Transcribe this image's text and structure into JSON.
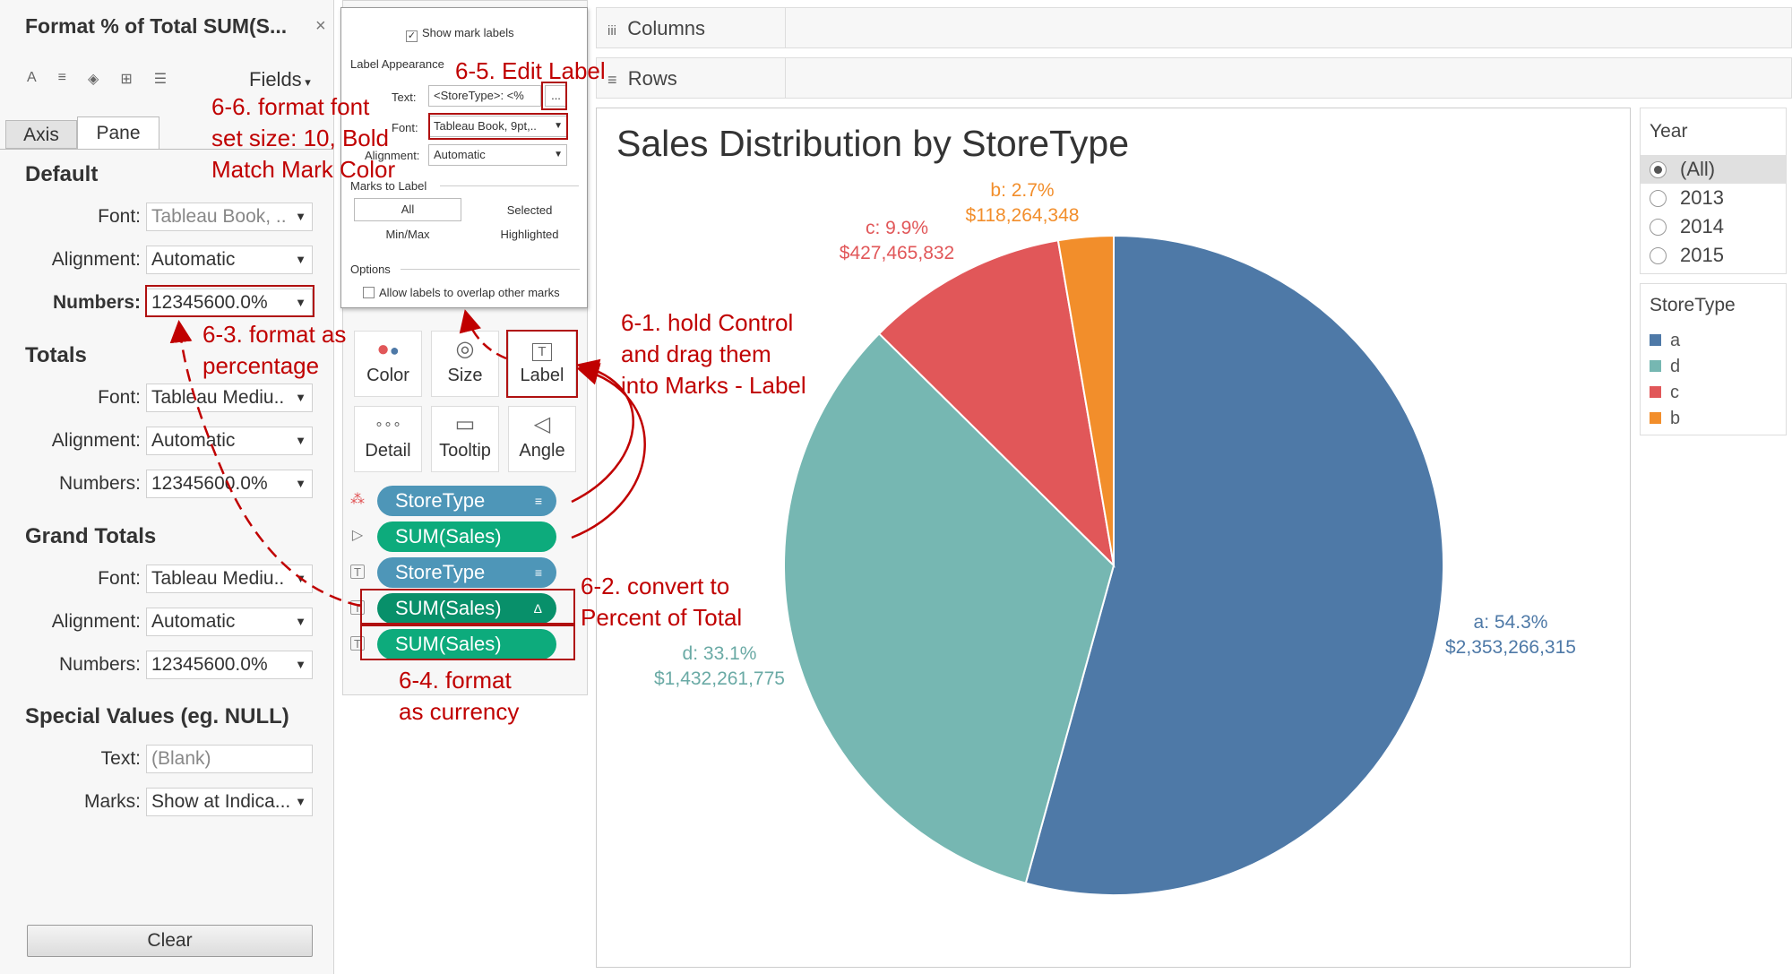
{
  "format_pane": {
    "title": "Format % of Total SUM(S...",
    "close": "×",
    "fields_label": "Fields",
    "tabs": {
      "axis": "Axis",
      "pane": "Pane"
    },
    "default": {
      "heading": "Default",
      "font_label": "Font:",
      "font_value": "Tableau Book, ..",
      "alignment_label": "Alignment:",
      "alignment_value": "Automatic",
      "numbers_label": "Numbers:",
      "numbers_value": "12345600.0%"
    },
    "totals": {
      "heading": "Totals",
      "font_label": "Font:",
      "font_value": "Tableau Mediu..",
      "alignment_label": "Alignment:",
      "alignment_value": "Automatic",
      "numbers_label": "Numbers:",
      "numbers_value": "12345600.0%"
    },
    "grand_totals": {
      "heading": "Grand Totals",
      "font_label": "Font:",
      "font_value": "Tableau Mediu..",
      "alignment_label": "Alignment:",
      "alignment_value": "Automatic",
      "numbers_label": "Numbers:",
      "numbers_value": "12345600.0%"
    },
    "special_values": {
      "heading": "Special Values (eg. NULL)",
      "text_label": "Text:",
      "text_placeholder": "(Blank)",
      "marks_label": "Marks:",
      "marks_value": "Show at Indica..."
    },
    "clear_label": "Clear"
  },
  "label_dialog": {
    "show_mark_labels": "Show mark labels",
    "label_appearance": "Label Appearance",
    "text_label": "Text:",
    "text_value": "<StoreType>: <%",
    "ellipsis": "...",
    "font_label": "Font:",
    "font_value": "Tableau Book, 9pt,..",
    "alignment_label": "Alignment:",
    "alignment_value": "Automatic",
    "marks_to_label": "Marks to Label",
    "all": "All",
    "selected": "Selected",
    "minmax": "Min/Max",
    "highlighted": "Highlighted",
    "options": "Options",
    "allow_overlap": "Allow labels to overlap other marks"
  },
  "marks_card": {
    "buttons": {
      "color": "Color",
      "size": "Size",
      "label": "Label",
      "detail": "Detail",
      "tooltip": "Tooltip",
      "angle": "Angle"
    },
    "pills": [
      "StoreType",
      "SUM(Sales)",
      "StoreType",
      "SUM(Sales)",
      "SUM(Sales)"
    ]
  },
  "shelves": {
    "columns": "Columns",
    "rows": "Rows"
  },
  "chart_data": {
    "type": "pie",
    "title": "Sales Distribution by StoreType",
    "slices": [
      {
        "name": "a",
        "percent": 54.3,
        "value": 2353266315,
        "percent_label": "a: 54.3%",
        "value_label": "$2,353,266,315",
        "color": "#4e79a7"
      },
      {
        "name": "d",
        "percent": 33.1,
        "value": 1432261775,
        "percent_label": "d: 33.1%",
        "value_label": "$1,432,261,775",
        "color": "#76b7b2"
      },
      {
        "name": "c",
        "percent": 9.9,
        "value": 427465832,
        "percent_label": "c: 9.9%",
        "value_label": "$427,465,832",
        "color": "#e15759"
      },
      {
        "name": "b",
        "percent": 2.7,
        "value": 118264348,
        "percent_label": "b: 2.7%",
        "value_label": "$118,264,348",
        "color": "#f28e2b"
      }
    ]
  },
  "year_filter": {
    "title": "Year",
    "options": [
      "(All)",
      "2013",
      "2014",
      "2015"
    ],
    "selected": "(All)"
  },
  "storetype_legend": {
    "title": "StoreType",
    "items": [
      {
        "label": "a",
        "color": "#4e79a7"
      },
      {
        "label": "d",
        "color": "#76b7b2"
      },
      {
        "label": "c",
        "color": "#e15759"
      },
      {
        "label": "b",
        "color": "#f28e2b"
      }
    ]
  },
  "annotations": {
    "a61": "6-1. hold Control\nand drag them\ninto Marks - Label",
    "a62": "6-2. convert to\nPercent of Total",
    "a63": "6-3. format as\npercentage",
    "a64": "6-4. format\nas currency",
    "a65": "6-5. Edit Label",
    "a66": "6-6. format font\nset size: 10, Bold\nMatch Mark Color"
  }
}
